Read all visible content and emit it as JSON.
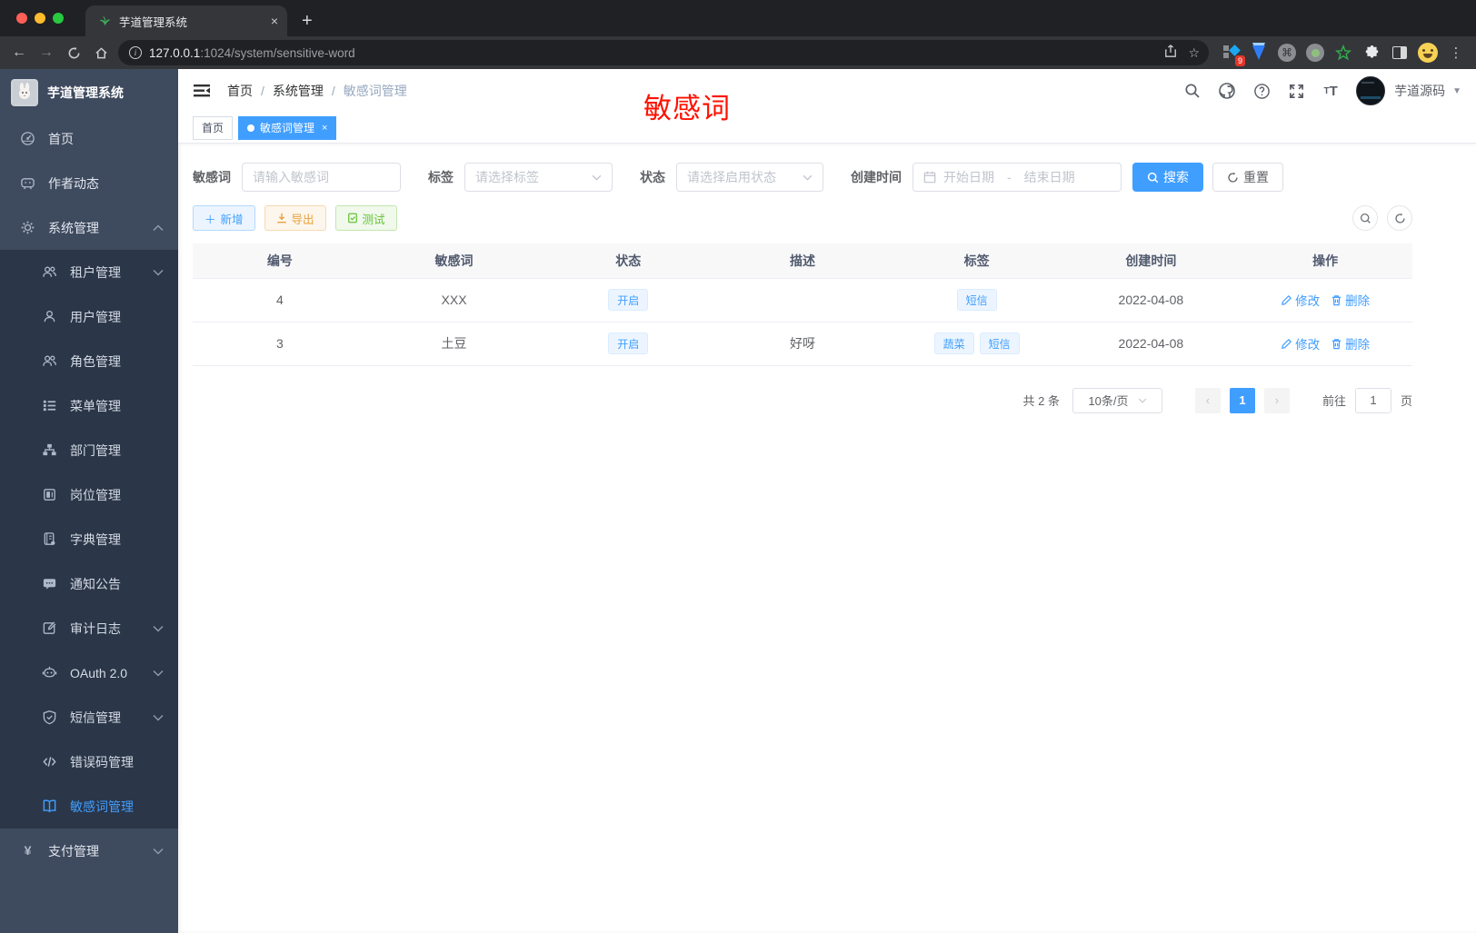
{
  "browser": {
    "tab_title": "芋道管理系统",
    "tab_close": "×",
    "new_tab": "+",
    "url_host": "127.0.0.1",
    "url_rest": ":1024/system/sensitive-word",
    "extension_badge": "9",
    "menu_dots": "⋮"
  },
  "sidebar": {
    "logo_title": "芋道管理系统",
    "items": [
      {
        "label": "首页",
        "icon": "dashboard-icon",
        "level": 1
      },
      {
        "label": "作者动态",
        "icon": "author-chat-icon",
        "level": 1
      },
      {
        "label": "系统管理",
        "icon": "gear-icon",
        "level": 1,
        "arrow": "up"
      },
      {
        "label": "租户管理",
        "icon": "tenant-users-icon",
        "level": 2,
        "arrow": "down"
      },
      {
        "label": "用户管理",
        "icon": "user-icon",
        "level": 2
      },
      {
        "label": "角色管理",
        "icon": "roles-icon",
        "level": 2
      },
      {
        "label": "菜单管理",
        "icon": "menu-list-icon",
        "level": 2
      },
      {
        "label": "部门管理",
        "icon": "dept-tree-icon",
        "level": 2
      },
      {
        "label": "岗位管理",
        "icon": "post-badge-icon",
        "level": 2
      },
      {
        "label": "字典管理",
        "icon": "dict-book-icon",
        "level": 2
      },
      {
        "label": "通知公告",
        "icon": "notice-message-icon",
        "level": 2
      },
      {
        "label": "审计日志",
        "icon": "audit-log-icon",
        "level": 2,
        "arrow": "down"
      },
      {
        "label": "OAuth 2.0",
        "icon": "oauth-robot-icon",
        "level": 2,
        "arrow": "down"
      },
      {
        "label": "短信管理",
        "icon": "sms-shield-icon",
        "level": 2,
        "arrow": "down"
      },
      {
        "label": "错误码管理",
        "icon": "error-code-icon",
        "level": 2
      },
      {
        "label": "敏感词管理",
        "icon": "sensitive-word-book-icon",
        "level": 2,
        "active": true
      },
      {
        "label": "支付管理",
        "icon": "payment-yen-icon",
        "level": 1,
        "arrow": "down"
      }
    ]
  },
  "header": {
    "breadcrumb": [
      "首页",
      "系统管理",
      "敏感词管理"
    ],
    "annotation": "敏感词",
    "username": "芋道源码"
  },
  "tabbar": {
    "tabs": [
      {
        "label": "首页",
        "active": false
      },
      {
        "label": "敏感词管理",
        "active": true,
        "closable": true
      }
    ]
  },
  "filters": {
    "keyword_label": "敏感词",
    "keyword_placeholder": "请输入敏感词",
    "tag_label": "标签",
    "tag_placeholder": "请选择标签",
    "status_label": "状态",
    "status_placeholder": "请选择启用状态",
    "created_label": "创建时间",
    "date_start_placeholder": "开始日期",
    "date_separator": "-",
    "date_end_placeholder": "结束日期",
    "search_label": "搜索",
    "reset_label": "重置"
  },
  "toolbar": {
    "add_label": "新增",
    "export_label": "导出",
    "test_label": "测试"
  },
  "table": {
    "headers": [
      "编号",
      "敏感词",
      "状态",
      "描述",
      "标签",
      "创建时间",
      "操作"
    ],
    "rows": [
      {
        "id": "4",
        "word": "XXX",
        "status": "开启",
        "desc": "",
        "tags": [
          "短信"
        ],
        "created": "2022-04-08",
        "edit": "修改",
        "delete": "删除"
      },
      {
        "id": "3",
        "word": "土豆",
        "status": "开启",
        "desc": "好呀",
        "tags": [
          "蔬菜",
          "短信"
        ],
        "created": "2022-04-08",
        "edit": "修改",
        "delete": "删除"
      }
    ]
  },
  "pagination": {
    "total": "共 2 条",
    "page_size": "10条/页",
    "current": "1",
    "goto_label": "前往",
    "goto_value": "1",
    "page_label": "页"
  },
  "colors": {
    "primary": "#409eff",
    "annotation_red": "#fe1100",
    "warning": "#e6a23c",
    "success": "#67c23a",
    "sidebar_bg": "#3e4a5e",
    "submenu_bg": "#2b3648"
  }
}
